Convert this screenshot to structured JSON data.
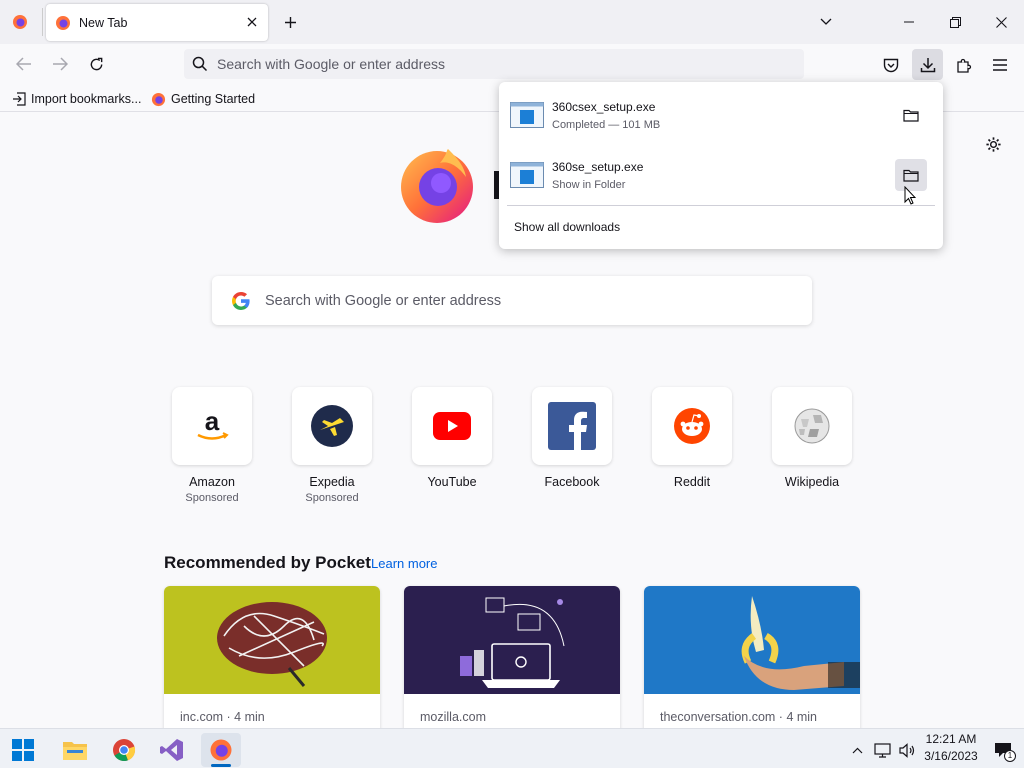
{
  "tabs": [
    {
      "title": "New Tab"
    }
  ],
  "navbar": {
    "url_placeholder": "Search with Google or enter address"
  },
  "bookmarks": [
    {
      "label": "Import bookmarks...",
      "icon": "import-icon"
    },
    {
      "label": "Getting Started",
      "icon": "firefox-icon"
    }
  ],
  "downloads": {
    "items": [
      {
        "filename": "360csex_setup.exe",
        "status": "Completed — 101 MB"
      },
      {
        "filename": "360se_setup.exe",
        "status": "Show in Folder"
      }
    ],
    "show_all": "Show all downloads"
  },
  "newtab": {
    "search_placeholder": "Search with Google or enter address",
    "shortcuts": [
      {
        "name": "Amazon",
        "sponsored": "Sponsored",
        "icon": "amazon-icon"
      },
      {
        "name": "Expedia",
        "sponsored": "Sponsored",
        "icon": "expedia-icon"
      },
      {
        "name": "YouTube",
        "sponsored": "",
        "icon": "youtube-icon"
      },
      {
        "name": "Facebook",
        "sponsored": "",
        "icon": "facebook-icon"
      },
      {
        "name": "Reddit",
        "sponsored": "",
        "icon": "reddit-icon"
      },
      {
        "name": "Wikipedia",
        "sponsored": "",
        "icon": "wikipedia-icon"
      }
    ],
    "pocket": {
      "title": "Recommended by Pocket",
      "learn_more": "Learn more",
      "cards": [
        {
          "source": "inc.com · 4 min"
        },
        {
          "source": "mozilla.com"
        },
        {
          "source": "theconversation.com · 4 min"
        }
      ]
    }
  },
  "taskbar": {
    "time": "12:21 AM",
    "date": "3/16/2023",
    "notification_count": "1"
  },
  "colors": {
    "accent": "#0061e0",
    "tab_bg": "#f0f0f4",
    "page_bg": "#f9f9fb",
    "firefox_orange": "#ff7139",
    "firefox_purple": "#7542e5"
  }
}
